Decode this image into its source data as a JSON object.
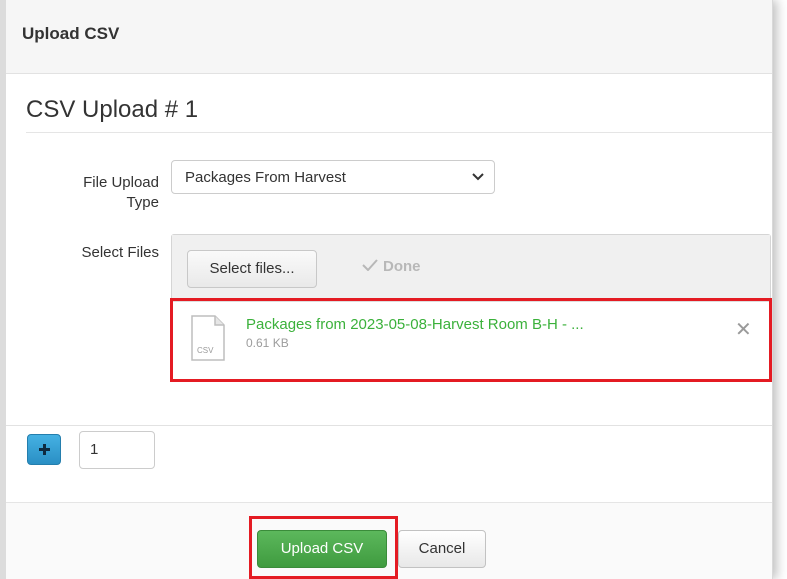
{
  "dialog": {
    "title": "Upload CSV"
  },
  "section": {
    "title": "CSV Upload # 1"
  },
  "form": {
    "file_upload_type_label_line1": "File Upload",
    "file_upload_type_label_line2": "Type",
    "file_upload_type_value": "Packages From Harvest",
    "select_files_label": "Select Files",
    "select_files_button": "Select files...",
    "done_label": "Done"
  },
  "uploaded_file": {
    "name": "Packages from 2023-05-08-Harvest Room B-H - ...",
    "size": "0.61 KB",
    "icon_text": "CSV",
    "remove_glyph": "✕"
  },
  "count": {
    "value": "1"
  },
  "footer": {
    "upload_button": "Upload CSV",
    "cancel_button": "Cancel"
  },
  "colors": {
    "highlight_border": "#e41b23",
    "upload_green": "#5cb85c",
    "add_blue": "#2a8fc4",
    "file_name_green": "#3bb13b"
  }
}
